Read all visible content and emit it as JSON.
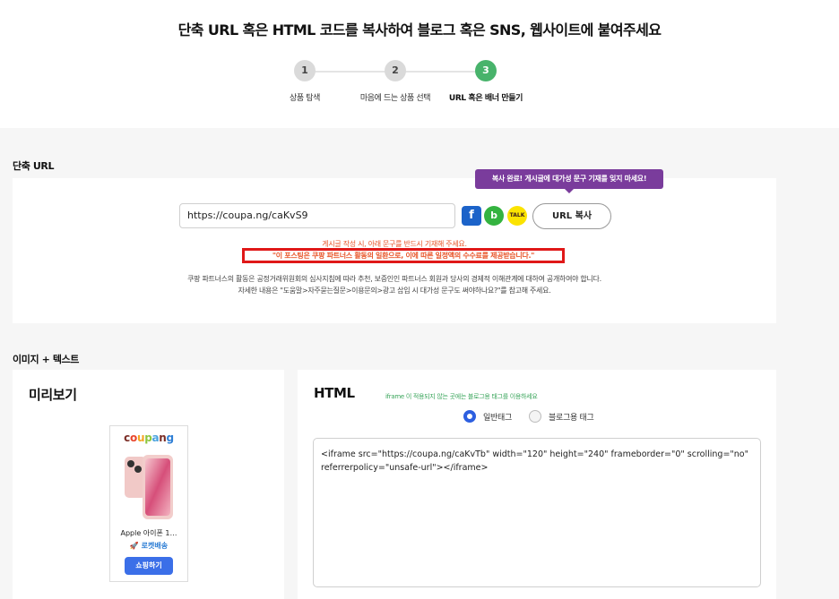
{
  "header": {
    "title": "단축 URL 혹은 HTML 코드를 복사하여 블로그 혹은 SNS, 웹사이트에 붙여주세요"
  },
  "stepper": {
    "steps": [
      {
        "number": "1",
        "label": "상품 탐색"
      },
      {
        "number": "2",
        "label": "마음에 드는 상품 선택"
      },
      {
        "number": "3",
        "label": "URL 혹은 배너 만들기"
      }
    ],
    "active_step": 3
  },
  "short_url": {
    "section_title": "단축 URL",
    "url_value": "https://coupa.ng/caKvS9",
    "copy_button_label": "URL 복사",
    "tooltip": "복사 완료! 게시글에 대가성 문구 기재를 잊지 마세요!",
    "share_icons": [
      "facebook-icon",
      "blog-icon",
      "kakaotalk-icon"
    ],
    "share_icon_glyphs": {
      "facebook": "f",
      "blog": "b",
      "kakao": "TALK"
    },
    "warning_line1": "게시글 작성 시, 아래 문구를 반드시 기재해 주세요.",
    "warning_line2": "\"이 포스팅은 쿠팡 파트너스 활동의 일환으로, 이에 따른 일정액의 수수료를 제공받습니다.\"",
    "info_line1": "쿠팡 파트너스의 활동은 공정거래위원회의 심사지침에 따라 추천, 보증인인 파트너스 회원과 당사의 경제적 이해관계에 대하여 공개하여야 합니다.",
    "info_line2": "자세한 내용은 \"도움말>자주묻는질문>이용문의>광고 삽입 시 대가성 문구도 써야하나요?\"를 참고해 주세요."
  },
  "image_text": {
    "section_title": "이미지 + 텍스트",
    "preview": {
      "title": "미리보기",
      "logo_parts": [
        "c",
        "o",
        "u",
        "p",
        "a",
        "n",
        "g"
      ],
      "logo_colors": [
        "#7b2d26",
        "#e8452c",
        "#f5a623",
        "#8cc63f",
        "#4aa3df",
        "#7b2d26",
        "#2f7fd5"
      ],
      "product_name": "Apple 아이폰 1…",
      "delivery": "🚀 로켓배송",
      "shop_button": "쇼핑하기"
    },
    "html": {
      "title": "HTML",
      "hint": "iframe 이 적용되지 않는 곳에는 블로그용 태그를 이용하세요",
      "radio_general": "일반태그",
      "radio_blog": "블로그용 태그",
      "selected": "일반태그",
      "code": "<iframe src=\"https://coupa.ng/caKvTb\" width=\"120\" height=\"240\" frameborder=\"0\" scrolling=\"no\" referrerpolicy=\"unsafe-url\"></iframe>"
    }
  },
  "colors": {
    "accent_green": "#48b36b",
    "warning_orange": "#e8562a",
    "highlight_red": "#e01818",
    "tooltip_purple": "#7a3c9c",
    "primary_blue": "#3b6fe8"
  }
}
